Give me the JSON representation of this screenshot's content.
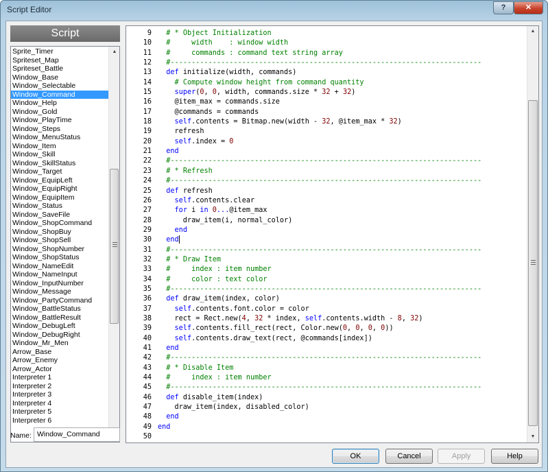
{
  "window": {
    "title": "Script Editor",
    "help_btn": "?",
    "close_btn": "✕"
  },
  "sidebar": {
    "header": "Script",
    "items": [
      "Sprite_Timer",
      "Spriteset_Map",
      "Spriteset_Battle",
      "Window_Base",
      "Window_Selectable",
      "Window_Command",
      "Window_Help",
      "Window_Gold",
      "Window_PlayTime",
      "Window_Steps",
      "Window_MenuStatus",
      "Window_Item",
      "Window_Skill",
      "Window_SkillStatus",
      "Window_Target",
      "Window_EquipLeft",
      "Window_EquipRight",
      "Window_EquipItem",
      "Window_Status",
      "Window_SaveFile",
      "Window_ShopCommand",
      "Window_ShopBuy",
      "Window_ShopSell",
      "Window_ShopNumber",
      "Window_ShopStatus",
      "Window_NameEdit",
      "Window_NameInput",
      "Window_InputNumber",
      "Window_Message",
      "Window_PartyCommand",
      "Window_BattleStatus",
      "Window_BattleResult",
      "Window_DebugLeft",
      "Window_DebugRight",
      "Window_Mr_Men",
      "Arrow_Base",
      "Arrow_Enemy",
      "Arrow_Actor",
      "Interpreter 1",
      "Interpreter 2",
      "Interpreter 3",
      "Interpreter 4",
      "Interpreter 5",
      "Interpreter 6"
    ],
    "selected_index": 5,
    "name_label": "Name:",
    "name_value": "Window_Command"
  },
  "editor": {
    "lines": [
      {
        "n": "9",
        "code": "  # * Object Initialization"
      },
      {
        "n": "10",
        "code": "  #     width    : window width"
      },
      {
        "n": "11",
        "code": "  #     commands : command text string array"
      },
      {
        "n": "12",
        "code": "  #--------------------------------------------------------------------------"
      },
      {
        "n": "13",
        "code": "  def initialize(width, commands)"
      },
      {
        "n": "14",
        "code": "    # Compute window height from command quantity"
      },
      {
        "n": "15",
        "code": "    super(0, 0, width, commands.size * 32 + 32)"
      },
      {
        "n": "16",
        "code": "    @item_max = commands.size"
      },
      {
        "n": "17",
        "code": "    @commands = commands"
      },
      {
        "n": "18",
        "code": "    self.contents = Bitmap.new(width - 32, @item_max * 32)"
      },
      {
        "n": "19",
        "code": "    refresh"
      },
      {
        "n": "20",
        "code": "    self.index = 0"
      },
      {
        "n": "21",
        "code": "  end"
      },
      {
        "n": "22",
        "code": "  #--------------------------------------------------------------------------"
      },
      {
        "n": "23",
        "code": "  # * Refresh"
      },
      {
        "n": "24",
        "code": "  #--------------------------------------------------------------------------"
      },
      {
        "n": "25",
        "code": "  def refresh"
      },
      {
        "n": "26",
        "code": "    self.contents.clear"
      },
      {
        "n": "27",
        "code": "    for i in 0...@item_max"
      },
      {
        "n": "28",
        "code": "      draw_item(i, normal_color)"
      },
      {
        "n": "29",
        "code": "    end"
      },
      {
        "n": "30",
        "code": "  end"
      },
      {
        "n": "31",
        "code": "  #--------------------------------------------------------------------------"
      },
      {
        "n": "32",
        "code": "  # * Draw Item"
      },
      {
        "n": "33",
        "code": "  #     index : item number"
      },
      {
        "n": "34",
        "code": "  #     color : text color"
      },
      {
        "n": "35",
        "code": "  #--------------------------------------------------------------------------"
      },
      {
        "n": "36",
        "code": "  def draw_item(index, color)"
      },
      {
        "n": "37",
        "code": "    self.contents.font.color = color"
      },
      {
        "n": "38",
        "code": "    rect = Rect.new(4, 32 * index, self.contents.width - 8, 32)"
      },
      {
        "n": "39",
        "code": "    self.contents.fill_rect(rect, Color.new(0, 0, 0, 0))"
      },
      {
        "n": "40",
        "code": "    self.contents.draw_text(rect, @commands[index])"
      },
      {
        "n": "41",
        "code": "  end"
      },
      {
        "n": "42",
        "code": "  #--------------------------------------------------------------------------"
      },
      {
        "n": "43",
        "code": "  # * Disable Item"
      },
      {
        "n": "44",
        "code": "  #     index : item number"
      },
      {
        "n": "45",
        "code": "  #--------------------------------------------------------------------------"
      },
      {
        "n": "46",
        "code": "  def disable_item(index)"
      },
      {
        "n": "47",
        "code": "    draw_item(index, disabled_color)"
      },
      {
        "n": "48",
        "code": "  end"
      },
      {
        "n": "49",
        "code": "end"
      },
      {
        "n": "50",
        "code": ""
      }
    ],
    "caret_line": 21
  },
  "buttons": {
    "ok": "OK",
    "cancel": "Cancel",
    "apply": "Apply",
    "help": "Help"
  },
  "colors": {
    "comment": "#008000",
    "keyword": "#0000ff",
    "number": "#800000",
    "self": "#0000ff",
    "selection": "#3399ff"
  }
}
